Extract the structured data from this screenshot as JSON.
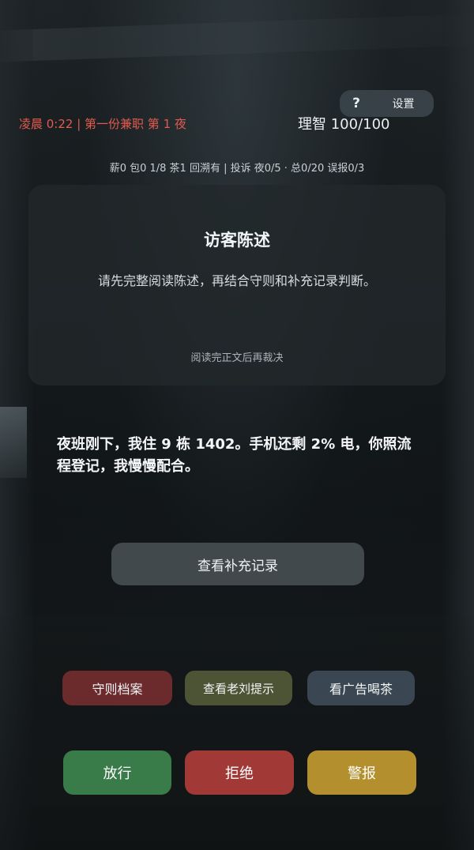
{
  "top": {
    "help_label": "?",
    "settings_label": "设置",
    "status_left": "凌晨 0:22 | 第一份兼职 第 1 夜",
    "sanity": "理智 100/100",
    "stats": "薪0 包0 1/8 茶1 回溯有 | 投诉 夜0/5 · 总0/20 误报0/3"
  },
  "card": {
    "title": "访客陈述",
    "description": "请先完整阅读陈述，再结合守则和补充记录判断。",
    "hint": "阅读完正文后再裁决"
  },
  "statement": "夜班刚下，我住 9 栋 1402。手机还剩 2% 电，你照流程登记，我慢慢配合。",
  "buttons": {
    "supplement": "查看补充记录",
    "rules": "守则档案",
    "tip": "查看老刘提示",
    "tea": "看广告喝茶",
    "pass": "放行",
    "reject": "拒绝",
    "alarm": "警报"
  },
  "colors": {
    "status_red": "#e35a4f",
    "rules_button": "#6b2a2c",
    "tip_button": "#4d5436",
    "tea_button": "#3a4651",
    "pass_button": "#3a7b4a",
    "reject_button": "#a13a37",
    "alarm_button": "#b3902d"
  }
}
